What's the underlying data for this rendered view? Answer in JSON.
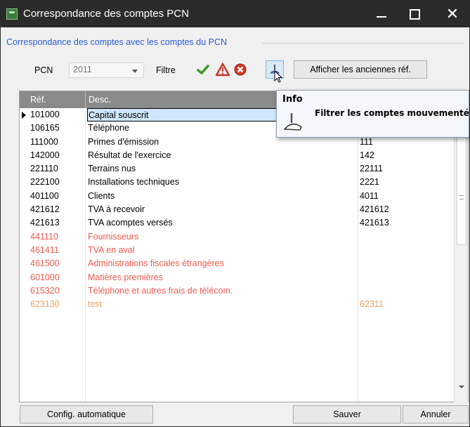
{
  "window": {
    "title": "Correspondance des comptes PCN",
    "controls": {
      "minimize": "_",
      "maximize": "□",
      "close": "✕"
    }
  },
  "group": {
    "label": "Correspondance des comptes avec les comptes du PCN"
  },
  "toolbar": {
    "pcn_label": "PCN",
    "pcn_value": "2011",
    "filter_label": "Filtre",
    "icons": [
      "checkmark-icon",
      "warning-icon",
      "error-icon",
      "filter-moved-icon"
    ],
    "old_refs_button": "Afficher les anciennes réf."
  },
  "grid": {
    "headers": {
      "ref": "Réf.",
      "desc": "Desc."
    },
    "rows": [
      {
        "ref": "101000",
        "desc": "Capital souscrit",
        "pcn": "",
        "style": "selected"
      },
      {
        "ref": "106165",
        "desc": "Téléphone",
        "pcn": "",
        "style": "normal"
      },
      {
        "ref": "111000",
        "desc": "Primes d'émission",
        "pcn": "111",
        "style": "normal"
      },
      {
        "ref": "142000",
        "desc": "Résultat de l'exercice",
        "pcn": "142",
        "style": "normal"
      },
      {
        "ref": "221110",
        "desc": "Terrains nus",
        "pcn": "22111",
        "style": "normal"
      },
      {
        "ref": "222100",
        "desc": "Installations techniques",
        "pcn": "2221",
        "style": "normal"
      },
      {
        "ref": "401100",
        "desc": "Clients",
        "pcn": "4011",
        "style": "normal"
      },
      {
        "ref": "421612",
        "desc": "TVA à recevoir",
        "pcn": "421612",
        "style": "normal"
      },
      {
        "ref": "421613",
        "desc": "TVA acomptes versés",
        "pcn": "421613",
        "style": "normal"
      },
      {
        "ref": "441110",
        "desc": "Fournisseurs",
        "pcn": "",
        "style": "red"
      },
      {
        "ref": "461411",
        "desc": "TVA en aval",
        "pcn": "",
        "style": "red"
      },
      {
        "ref": "461500",
        "desc": "Administrations fiscales étrangères",
        "pcn": "",
        "style": "red"
      },
      {
        "ref": "601000",
        "desc": "Matières premières",
        "pcn": "",
        "style": "red"
      },
      {
        "ref": "615320",
        "desc": "Téléphone et autres frais de télécom.",
        "pcn": "",
        "style": "red"
      },
      {
        "ref": "623130",
        "desc": "test",
        "pcn": "62311",
        "style": "orange"
      }
    ]
  },
  "tooltip": {
    "title": "Info",
    "text": "Filtrer les comptes mouvementés"
  },
  "footer": {
    "config_button": "Config. automatique",
    "save_button": "Sauver",
    "cancel_button": "Annuler"
  },
  "colors": {
    "titlebar": "#2b2b2b",
    "group_label": "#2b5cd6",
    "unmatched_row": "#f05a4f",
    "partial_row": "#f0a060",
    "selection": "#cfe6fb",
    "header_bg": "#8a8a8a"
  }
}
